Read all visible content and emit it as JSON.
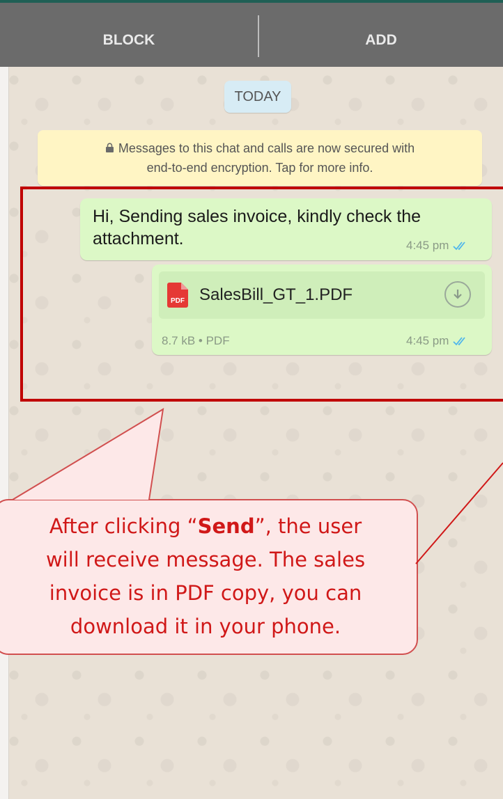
{
  "topbar": {
    "block_label": "BLOCK",
    "add_label": "ADD"
  },
  "date_chip": "TODAY",
  "encryption_notice": {
    "line1": "Messages to this chat and calls are now secured with",
    "line2": "end-to-end encryption. Tap for more info.",
    "icon": "lock-icon"
  },
  "messages": [
    {
      "type": "text",
      "line1": "Hi, Sending sales invoice, kindly check the",
      "line2": "attachment.",
      "time": "4:45 pm",
      "status_icon": "double-check-icon"
    },
    {
      "type": "document",
      "file_name": "SalesBill_GT_1.PDF",
      "file_badge": "PDF",
      "meta": "8.7 kB • PDF",
      "time": "4:45 pm",
      "status_icon": "double-check-icon",
      "action_icon": "download-icon"
    }
  ],
  "callout": {
    "line1_prefix": "After clicking “",
    "line1_bold": "Send",
    "line1_suffix": "”, the user",
    "line2": "will receive message. The sales",
    "line3": "invoice is in PDF copy, you can",
    "line4": "download it in your phone."
  },
  "colors": {
    "topbar": "#6b6b6b",
    "bubble": "#dcf8c6",
    "highlight": "#c00000",
    "callout_text": "#d01818",
    "callout_bg": "#fde8e8",
    "ticks": "#4fb6ec"
  }
}
